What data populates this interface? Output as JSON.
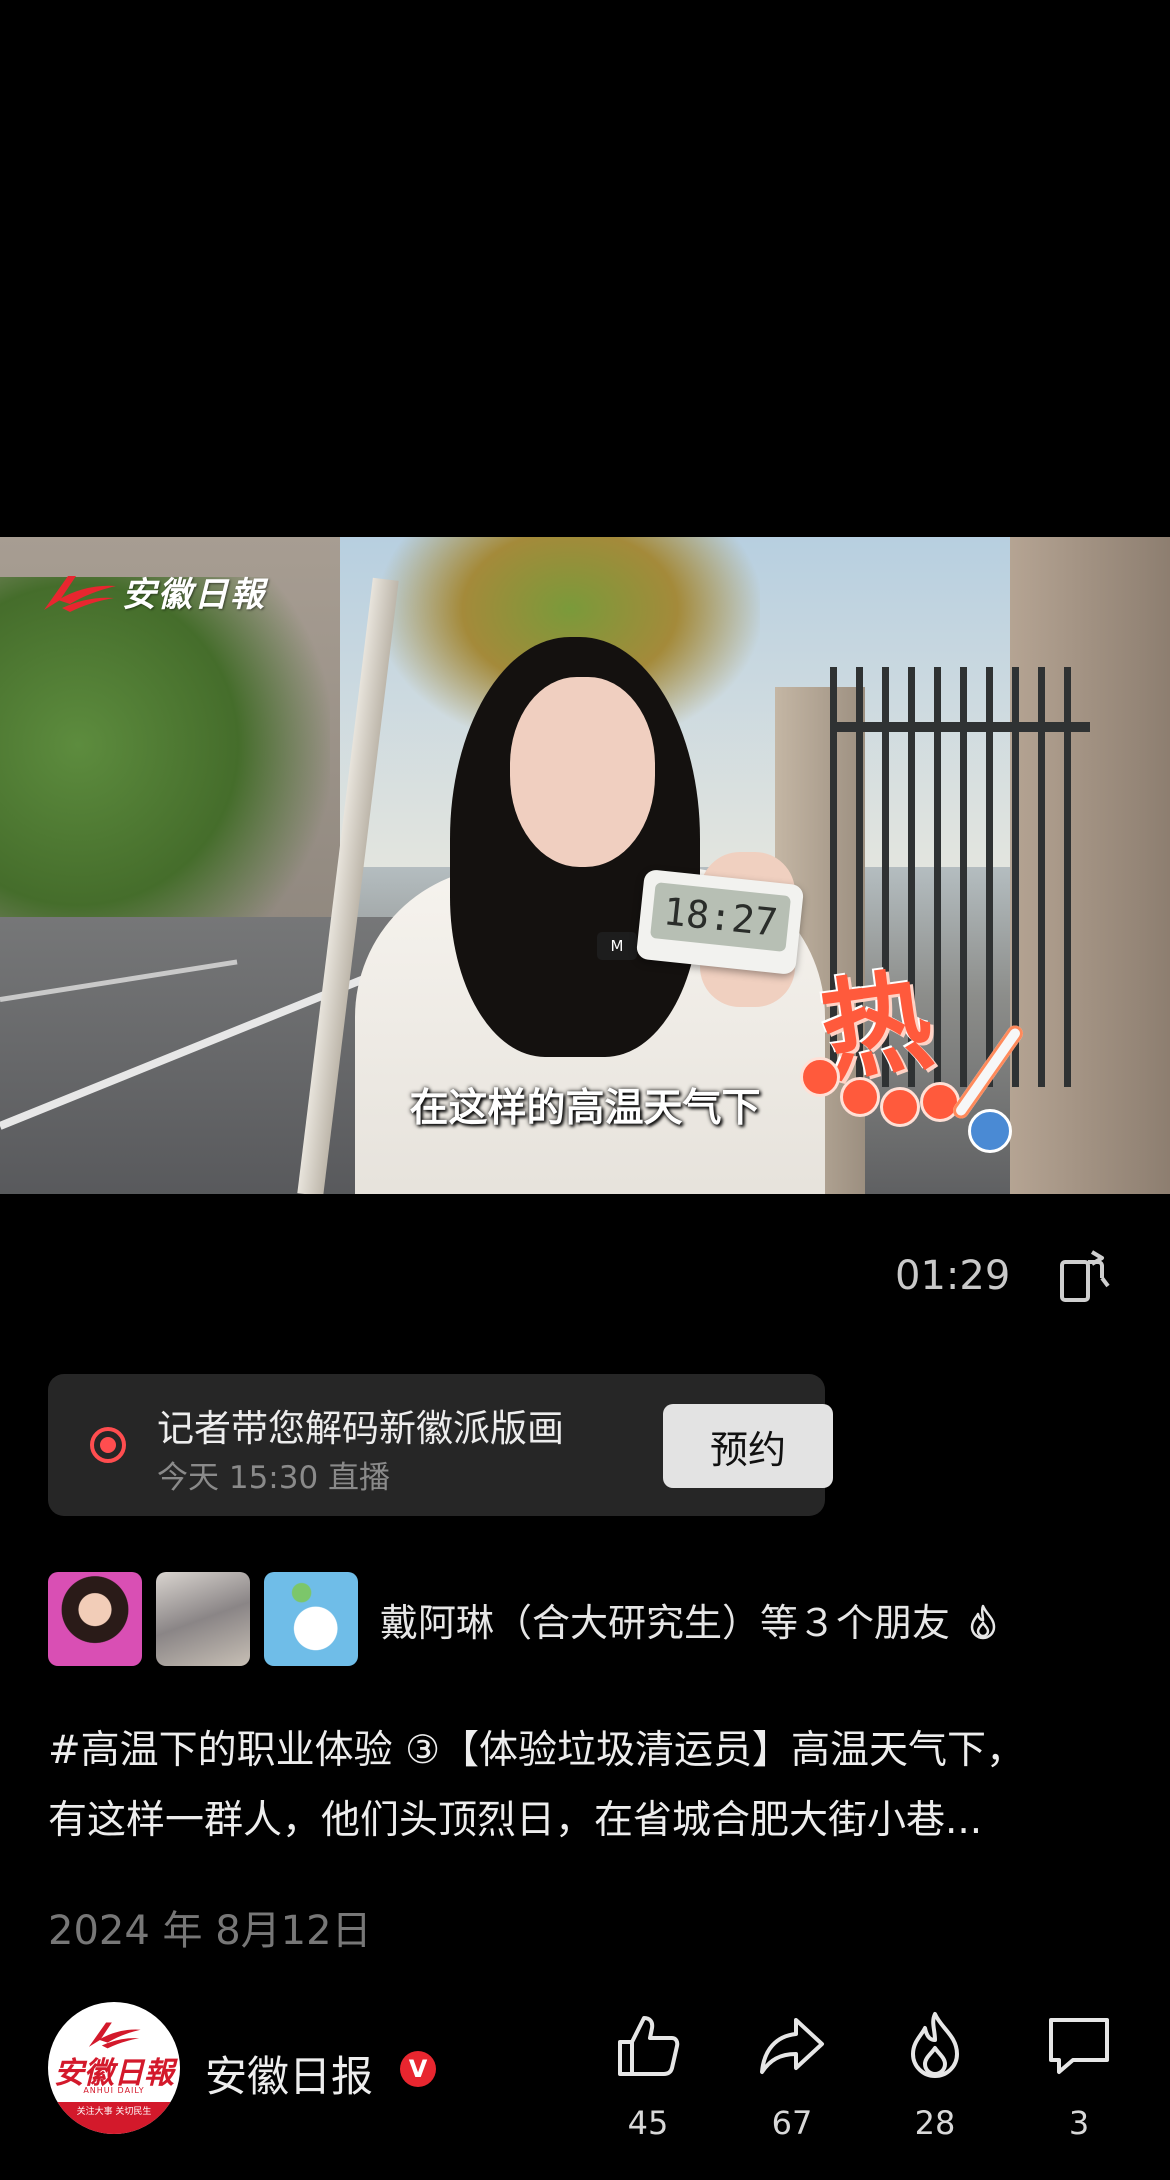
{
  "video": {
    "logo_text": "安徽日報",
    "subtitle": "在这样的高温天气下",
    "clock_reading": "18:27",
    "sticker_text": "热",
    "mic_label": "M"
  },
  "player": {
    "duration": "01:29",
    "rotate_icon": "rotate-screen-icon"
  },
  "live": {
    "title": "记者带您解码新徽派版画",
    "time": "今天 15:30 直播",
    "button_label": "预约",
    "accent": "#ff4d4f"
  },
  "friends": {
    "text": "戴阿琳（合大研究生）等３个朋友"
  },
  "post": {
    "description_lines": [
      "#高温下的职业体验 ③【体验垃圾清运员】高温天气下，",
      "有这样一群人，他们头顶烈日，在省城合肥大街小巷..."
    ],
    "date": "2024 年 8月12日"
  },
  "account": {
    "name": "安徽日报",
    "verified_mark": "V",
    "avatar_text": "安徽日報",
    "avatar_sub": "ANHUI DAILY",
    "avatar_band": "关注大事 关切民生",
    "brand_color": "#d3192b"
  },
  "actions": {
    "like": {
      "icon": "thumbs-up-icon",
      "count": "45"
    },
    "share": {
      "icon": "share-icon",
      "count": "67"
    },
    "hot": {
      "icon": "flame-icon",
      "count": "28"
    },
    "comment": {
      "icon": "comment-icon",
      "count": "3"
    }
  }
}
